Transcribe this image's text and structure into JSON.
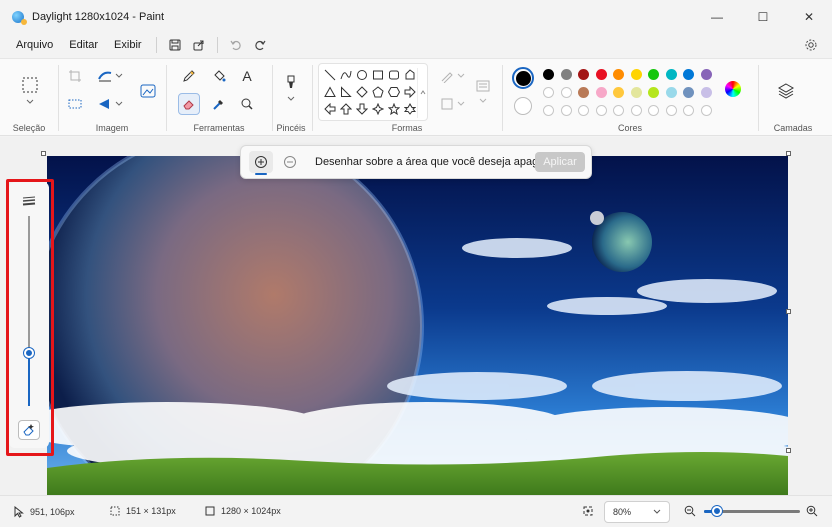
{
  "window": {
    "title": "Daylight 1280x1024 - Paint",
    "controls": {
      "minimize": "—",
      "maximize": "☐",
      "close": "✕"
    }
  },
  "menu": {
    "items": [
      "Arquivo",
      "Editar",
      "Exibir"
    ],
    "icons": [
      "save-icon",
      "share-icon",
      "undo-icon",
      "redo-icon"
    ]
  },
  "ribbon": {
    "groups": {
      "selection": "Seleção",
      "image": "Imagem",
      "tools": "Ferramentas",
      "brushes": "Pincéis",
      "shapes": "Formas",
      "colors": "Cores",
      "layers": "Camadas"
    },
    "text_tool": "A",
    "current_color_primary": "#000000",
    "current_color_secondary": "#ffffff",
    "palette": [
      "#000000",
      "#808080",
      "#a31515",
      "#e81123",
      "#ff8c00",
      "#ffd400",
      "#16c60c",
      "#00b7c3",
      "#0078d7",
      "#8764b8",
      "#ffffff",
      "#c3c3c3",
      "#b97a57",
      "#f7a8c8",
      "#ffc83d",
      "#e3e69c",
      "#b5e61d",
      "#99d9ea",
      "#7092be",
      "#c8bfe7"
    ]
  },
  "floating_toolbar": {
    "hint": "Desenhar sobre a área que você deseja apagar",
    "apply": "Aplicar"
  },
  "slider": {
    "level": 0.28
  },
  "status": {
    "cursor": "951, 106px",
    "selection": "151 × 131px",
    "canvas_size": "1280 × 1024px",
    "zoom": "80%",
    "zoom_slider_level": 0.14
  }
}
